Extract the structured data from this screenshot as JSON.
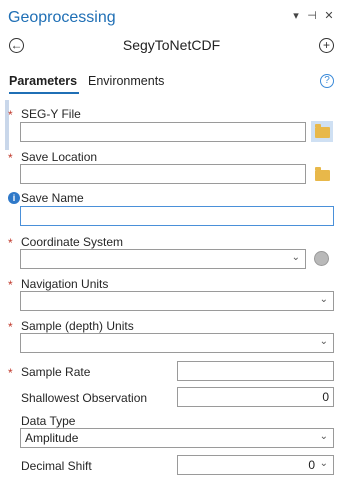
{
  "window": {
    "title": "Geoprocessing",
    "chevron_icon": "▾",
    "pin_icon": "⊣",
    "close_icon": "✕"
  },
  "header": {
    "back_icon": "←",
    "tool_name": "SegyToNetCDF",
    "add_icon": "+"
  },
  "tabs": [
    {
      "label": "Parameters",
      "active": true
    },
    {
      "label": "Environments",
      "active": false
    }
  ],
  "help_icon": "?",
  "params": {
    "segy_file": {
      "label": "SEG-Y File",
      "value": "",
      "required": true
    },
    "save_location": {
      "label": "Save Location",
      "value": "",
      "required": true
    },
    "save_name": {
      "label": "Save Name",
      "value": ""
    },
    "coordinate_system": {
      "label": "Coordinate System",
      "value": "",
      "required": true
    },
    "navigation_units": {
      "label": "Navigation Units",
      "value": "",
      "required": true
    },
    "sample_units": {
      "label": "Sample (depth) Units",
      "value": "",
      "required": true
    },
    "sample_rate": {
      "label": "Sample Rate",
      "value": "",
      "required": true
    },
    "shallowest_observation": {
      "label": "Shallowest Observation",
      "value": "0"
    },
    "data_type": {
      "label": "Data Type",
      "value": "Amplitude"
    },
    "decimal_shift": {
      "label": "Decimal Shift",
      "value": "0"
    }
  },
  "glyphs": {
    "required_mark": "*",
    "dropdown": "⌄",
    "info": "i"
  },
  "colors": {
    "accent": "#1f6fb5",
    "required": "#c0392b",
    "folder": "#e8b84a",
    "info": "#2f79c9"
  }
}
